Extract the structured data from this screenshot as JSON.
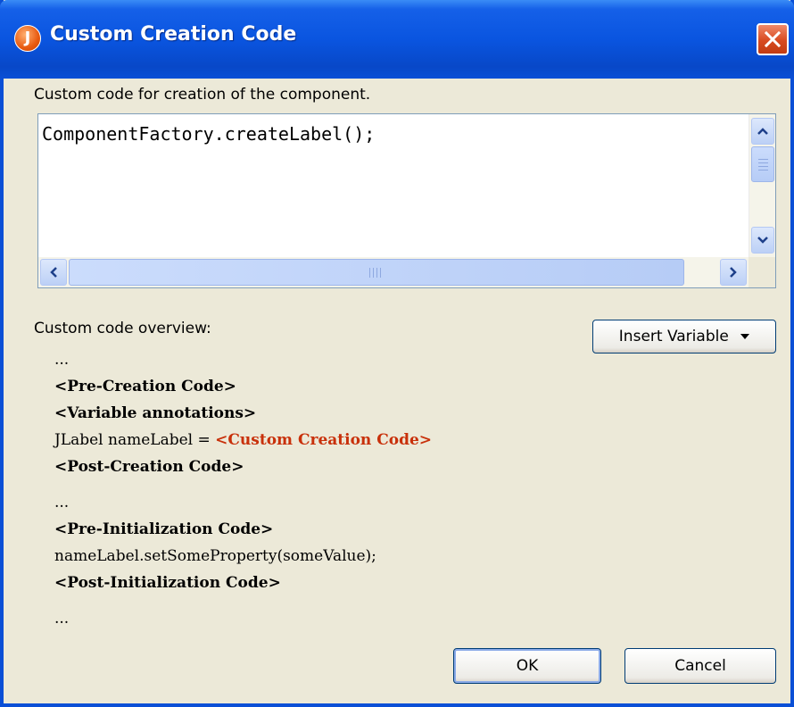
{
  "window": {
    "title": "Custom Creation Code",
    "app_icon_letter": "J"
  },
  "editor": {
    "label": "Custom code for creation of the component.",
    "value": "ComponentFactory.createLabel();"
  },
  "overview": {
    "label": "Custom code overview:",
    "insert_variable_label": "Insert Variable",
    "lines": [
      "...",
      "<Pre-Creation Code>",
      "<Variable annotations>",
      "JLabel nameLabel = ",
      "<Custom Creation Code>",
      "<Post-Creation Code>",
      "...",
      "<Pre-Initialization Code>",
      "nameLabel.setSomeProperty(someValue);",
      "<Post-Initialization Code>",
      "..."
    ]
  },
  "buttons": {
    "ok": "OK",
    "cancel": "Cancel"
  },
  "colors": {
    "titlebar": "#0a55e0",
    "highlight": "#c8300a",
    "dialog_bg": "#ece9d8"
  }
}
